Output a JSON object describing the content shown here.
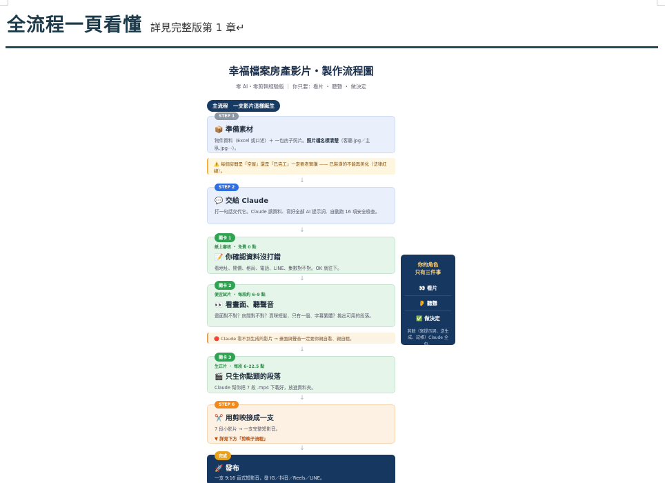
{
  "document": {
    "title": "全流程一頁看懂",
    "subtitle": "詳見完整版第 1 章↵"
  },
  "flowchart": {
    "title": "幸福檔案房產影片・製作流程圖",
    "caption": "零 AI・零剪輯經驗版 ｜ 你只要：看片 ・ 聽聲 ・ 做決定",
    "main_label": "主流程　一支影片這樣誕生",
    "steps": [
      {
        "badge": "STEP 1",
        "title": "📦 準備素材",
        "text_before": "物件資料（Excel 或口述）＋ 一包房子照片。",
        "text_bold": "照片檔名標清楚",
        "text_after": "（客廳.jpg／主臥.jpg⋯）。"
      },
      {
        "note": "⚠️ 每個房間是「空屋」還是「已完工」一定要老實講 —— 已裝潢的不能再美化（法律紅線）。"
      },
      {
        "badge": "STEP 2",
        "title": "💬 交給 Claude",
        "text": "打一句話交代它。Claude 讀資料、寫好全部 AI 提示詞、自動跑 16 項安全檢查。"
      },
      {
        "badge": "關卡 1",
        "kicker": "紙上審核 ・ 免費 0 點",
        "title": "📝 你確認資料沒打錯",
        "text": "看地址、開價、格局、電話、LINE、集數對不對。OK 就往下。"
      },
      {
        "badge": "關卡 2",
        "kicker": "便宜試片 ・ 每段約 6–9 點",
        "title": "👀 看畫面、聽聲音",
        "text": "畫面對不對？房間對不對？賣咪短髮、只有一個、字幕繁體？挑出可用的段落。"
      },
      {
        "note": "🔴 Claude 看不到生成的影片 → 畫面與聲音一定要你親自看、親自聽。"
      },
      {
        "badge": "關卡 3",
        "kicker": "生正片 ・ 每段 6–22.5 點",
        "title": "🎬 只生你點頭的段落",
        "text": "Claude 幫你把 7 段 .mp4 下載好，放進資料夾。"
      },
      {
        "badge": "STEP 6",
        "title": "✂️ 用剪映接成一支",
        "text": "7 段小影片 → 一支完整短影音。",
        "link": "▼ 詳見下方「剪映子流程」"
      },
      {
        "badge": "完成",
        "title": "🚀 發布",
        "text": "一支 9:16 直式短影音，發 IG／抖音／Reels／LINE。"
      }
    ]
  },
  "role_panel": {
    "title": "你的角色\n只有三件事",
    "items": [
      "👀 看片",
      "👂 聽聲",
      "✅ 做決定"
    ],
    "footer": "其餘（寫提示詞、送生成、記帳）Claude 全包。"
  },
  "colors": {
    "heading": "#1d3a4a",
    "rule": "#1e4d57",
    "navy": "#163760",
    "step_blue": "#2f6fe0",
    "gate_green": "#2fa352",
    "step_orange": "#f08a1c"
  }
}
